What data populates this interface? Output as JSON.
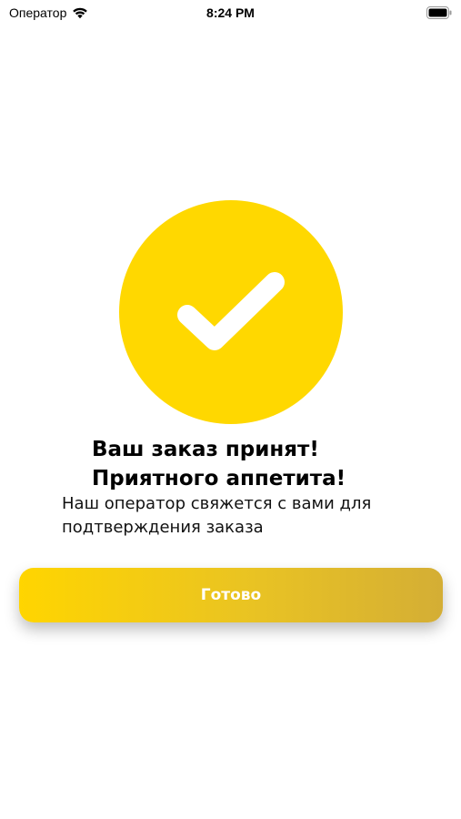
{
  "status_bar": {
    "carrier": "Оператор",
    "time": "8:24 PM",
    "wifi_icon": "wifi-icon",
    "battery_icon": "battery-icon"
  },
  "success": {
    "icon": "checkmark-icon",
    "circle_color": "#FFD800"
  },
  "message": {
    "headline_line1": "Ваш заказ принят!",
    "headline_line2": "Приятного аппетита!",
    "subtitle_line1": "Наш оператор свяжется с вами для",
    "subtitle_line2": "подтверждения заказа"
  },
  "actions": {
    "done_label": "Готово"
  },
  "colors": {
    "accent": "#FFD800",
    "button_gradient_start": "#FFD500",
    "button_gradient_end": "#D4AE35",
    "button_text": "#FFFFFF"
  }
}
